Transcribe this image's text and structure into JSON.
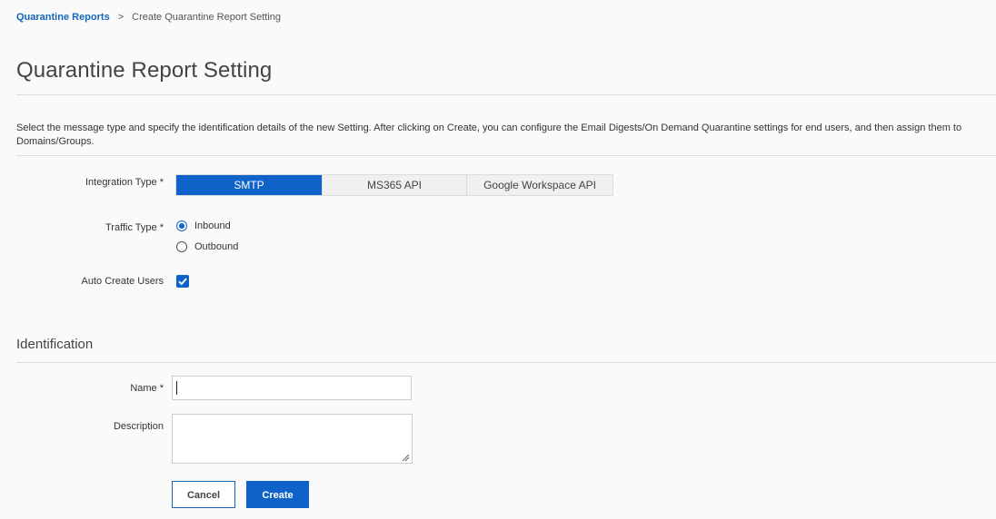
{
  "breadcrumb": {
    "parent": "Quarantine Reports",
    "separator": ">",
    "current": "Create Quarantine Report Setting"
  },
  "page": {
    "title": "Quarantine Report Setting",
    "intro": "Select the message type and specify the identification details of the new Setting. After clicking on Create, you can configure the Email Digests/On Demand Quarantine settings for end users, and then assign them to Domains/Groups."
  },
  "form": {
    "integration_type": {
      "label": "Integration Type *",
      "options": [
        "SMTP",
        "MS365 API",
        "Google Workspace API"
      ],
      "selected": "SMTP"
    },
    "traffic_type": {
      "label": "Traffic Type *",
      "options": [
        "Inbound",
        "Outbound"
      ],
      "selected": "Inbound"
    },
    "auto_create_users": {
      "label": "Auto Create Users",
      "checked": true
    }
  },
  "identification": {
    "title": "Identification",
    "name_label": "Name *",
    "name_value": "",
    "description_label": "Description",
    "description_value": ""
  },
  "actions": {
    "cancel_label": "Cancel",
    "create_label": "Create"
  },
  "colors": {
    "accent": "#0e62c8",
    "link": "#1466b8",
    "background": "#fafafa"
  }
}
